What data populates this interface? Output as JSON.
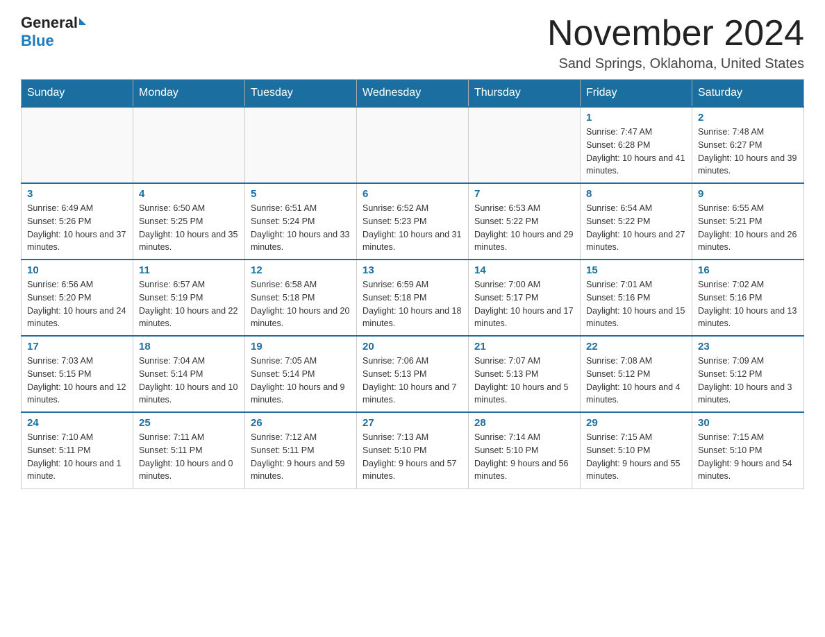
{
  "header": {
    "logo_general": "General",
    "logo_blue": "Blue",
    "month_title": "November 2024",
    "location": "Sand Springs, Oklahoma, United States"
  },
  "weekdays": [
    "Sunday",
    "Monday",
    "Tuesday",
    "Wednesday",
    "Thursday",
    "Friday",
    "Saturday"
  ],
  "weeks": [
    [
      {
        "day": "",
        "sunrise": "",
        "sunset": "",
        "daylight": ""
      },
      {
        "day": "",
        "sunrise": "",
        "sunset": "",
        "daylight": ""
      },
      {
        "day": "",
        "sunrise": "",
        "sunset": "",
        "daylight": ""
      },
      {
        "day": "",
        "sunrise": "",
        "sunset": "",
        "daylight": ""
      },
      {
        "day": "",
        "sunrise": "",
        "sunset": "",
        "daylight": ""
      },
      {
        "day": "1",
        "sunrise": "Sunrise: 7:47 AM",
        "sunset": "Sunset: 6:28 PM",
        "daylight": "Daylight: 10 hours and 41 minutes."
      },
      {
        "day": "2",
        "sunrise": "Sunrise: 7:48 AM",
        "sunset": "Sunset: 6:27 PM",
        "daylight": "Daylight: 10 hours and 39 minutes."
      }
    ],
    [
      {
        "day": "3",
        "sunrise": "Sunrise: 6:49 AM",
        "sunset": "Sunset: 5:26 PM",
        "daylight": "Daylight: 10 hours and 37 minutes."
      },
      {
        "day": "4",
        "sunrise": "Sunrise: 6:50 AM",
        "sunset": "Sunset: 5:25 PM",
        "daylight": "Daylight: 10 hours and 35 minutes."
      },
      {
        "day": "5",
        "sunrise": "Sunrise: 6:51 AM",
        "sunset": "Sunset: 5:24 PM",
        "daylight": "Daylight: 10 hours and 33 minutes."
      },
      {
        "day": "6",
        "sunrise": "Sunrise: 6:52 AM",
        "sunset": "Sunset: 5:23 PM",
        "daylight": "Daylight: 10 hours and 31 minutes."
      },
      {
        "day": "7",
        "sunrise": "Sunrise: 6:53 AM",
        "sunset": "Sunset: 5:22 PM",
        "daylight": "Daylight: 10 hours and 29 minutes."
      },
      {
        "day": "8",
        "sunrise": "Sunrise: 6:54 AM",
        "sunset": "Sunset: 5:22 PM",
        "daylight": "Daylight: 10 hours and 27 minutes."
      },
      {
        "day": "9",
        "sunrise": "Sunrise: 6:55 AM",
        "sunset": "Sunset: 5:21 PM",
        "daylight": "Daylight: 10 hours and 26 minutes."
      }
    ],
    [
      {
        "day": "10",
        "sunrise": "Sunrise: 6:56 AM",
        "sunset": "Sunset: 5:20 PM",
        "daylight": "Daylight: 10 hours and 24 minutes."
      },
      {
        "day": "11",
        "sunrise": "Sunrise: 6:57 AM",
        "sunset": "Sunset: 5:19 PM",
        "daylight": "Daylight: 10 hours and 22 minutes."
      },
      {
        "day": "12",
        "sunrise": "Sunrise: 6:58 AM",
        "sunset": "Sunset: 5:18 PM",
        "daylight": "Daylight: 10 hours and 20 minutes."
      },
      {
        "day": "13",
        "sunrise": "Sunrise: 6:59 AM",
        "sunset": "Sunset: 5:18 PM",
        "daylight": "Daylight: 10 hours and 18 minutes."
      },
      {
        "day": "14",
        "sunrise": "Sunrise: 7:00 AM",
        "sunset": "Sunset: 5:17 PM",
        "daylight": "Daylight: 10 hours and 17 minutes."
      },
      {
        "day": "15",
        "sunrise": "Sunrise: 7:01 AM",
        "sunset": "Sunset: 5:16 PM",
        "daylight": "Daylight: 10 hours and 15 minutes."
      },
      {
        "day": "16",
        "sunrise": "Sunrise: 7:02 AM",
        "sunset": "Sunset: 5:16 PM",
        "daylight": "Daylight: 10 hours and 13 minutes."
      }
    ],
    [
      {
        "day": "17",
        "sunrise": "Sunrise: 7:03 AM",
        "sunset": "Sunset: 5:15 PM",
        "daylight": "Daylight: 10 hours and 12 minutes."
      },
      {
        "day": "18",
        "sunrise": "Sunrise: 7:04 AM",
        "sunset": "Sunset: 5:14 PM",
        "daylight": "Daylight: 10 hours and 10 minutes."
      },
      {
        "day": "19",
        "sunrise": "Sunrise: 7:05 AM",
        "sunset": "Sunset: 5:14 PM",
        "daylight": "Daylight: 10 hours and 9 minutes."
      },
      {
        "day": "20",
        "sunrise": "Sunrise: 7:06 AM",
        "sunset": "Sunset: 5:13 PM",
        "daylight": "Daylight: 10 hours and 7 minutes."
      },
      {
        "day": "21",
        "sunrise": "Sunrise: 7:07 AM",
        "sunset": "Sunset: 5:13 PM",
        "daylight": "Daylight: 10 hours and 5 minutes."
      },
      {
        "day": "22",
        "sunrise": "Sunrise: 7:08 AM",
        "sunset": "Sunset: 5:12 PM",
        "daylight": "Daylight: 10 hours and 4 minutes."
      },
      {
        "day": "23",
        "sunrise": "Sunrise: 7:09 AM",
        "sunset": "Sunset: 5:12 PM",
        "daylight": "Daylight: 10 hours and 3 minutes."
      }
    ],
    [
      {
        "day": "24",
        "sunrise": "Sunrise: 7:10 AM",
        "sunset": "Sunset: 5:11 PM",
        "daylight": "Daylight: 10 hours and 1 minute."
      },
      {
        "day": "25",
        "sunrise": "Sunrise: 7:11 AM",
        "sunset": "Sunset: 5:11 PM",
        "daylight": "Daylight: 10 hours and 0 minutes."
      },
      {
        "day": "26",
        "sunrise": "Sunrise: 7:12 AM",
        "sunset": "Sunset: 5:11 PM",
        "daylight": "Daylight: 9 hours and 59 minutes."
      },
      {
        "day": "27",
        "sunrise": "Sunrise: 7:13 AM",
        "sunset": "Sunset: 5:10 PM",
        "daylight": "Daylight: 9 hours and 57 minutes."
      },
      {
        "day": "28",
        "sunrise": "Sunrise: 7:14 AM",
        "sunset": "Sunset: 5:10 PM",
        "daylight": "Daylight: 9 hours and 56 minutes."
      },
      {
        "day": "29",
        "sunrise": "Sunrise: 7:15 AM",
        "sunset": "Sunset: 5:10 PM",
        "daylight": "Daylight: 9 hours and 55 minutes."
      },
      {
        "day": "30",
        "sunrise": "Sunrise: 7:15 AM",
        "sunset": "Sunset: 5:10 PM",
        "daylight": "Daylight: 9 hours and 54 minutes."
      }
    ]
  ]
}
